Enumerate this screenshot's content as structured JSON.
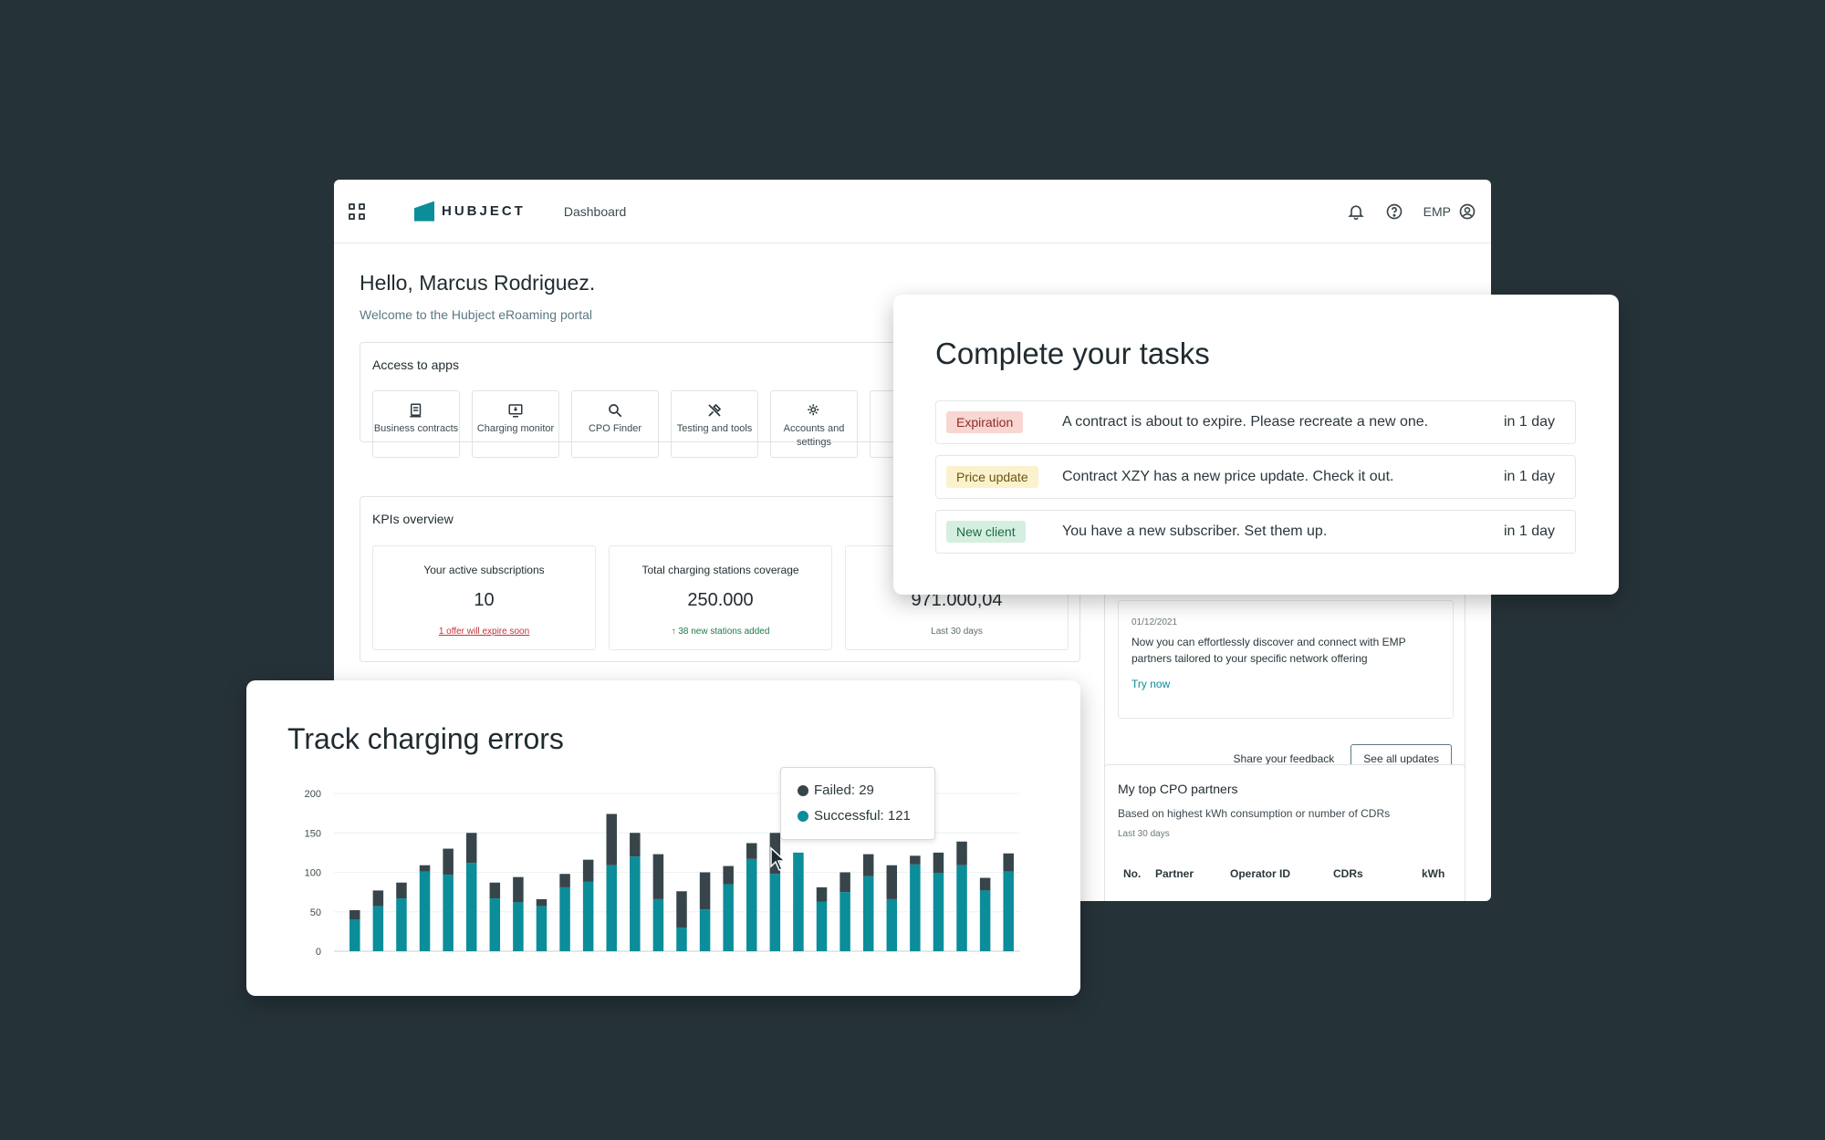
{
  "header": {
    "brand": "HUBJECT",
    "nav_item": "Dashboard",
    "role": "EMP"
  },
  "greeting": {
    "title": "Hello, Marcus Rodriguez.",
    "subtitle": "Welcome to the Hubject eRoaming portal"
  },
  "apps": {
    "title": "Access to apps",
    "items": [
      {
        "label": "Business contracts",
        "icon": "document-icon"
      },
      {
        "label": "Charging monitor",
        "icon": "monitor-icon"
      },
      {
        "label": "CPO Finder",
        "icon": "search-icon"
      },
      {
        "label": "Testing and tools",
        "icon": "tools-icon"
      },
      {
        "label": "Accounts and settings",
        "icon": "settings-icon"
      }
    ]
  },
  "kpis": {
    "title": "KPIs overview",
    "cards": [
      {
        "label": "Your active subscriptions",
        "value": "10",
        "note": "1 offer will expire soon"
      },
      {
        "label": "Total charging stations coverage",
        "value": "250.000",
        "note": "38 new stations added"
      },
      {
        "label": "",
        "value": "971.000,04",
        "note": "Last 30 days"
      }
    ]
  },
  "updates": {
    "date": "01/12/2021",
    "text": "Now you can effortlessly discover and connect with EMP partners tailored to your specific network offering",
    "link": "Try now",
    "feedback": "Share your feedback",
    "button": "See all updates"
  },
  "cpo_partners": {
    "title": "My top CPO partners",
    "subtitle": "Based on highest kWh consumption or number of CDRs",
    "range": "Last 30 days",
    "columns": [
      "No.",
      "Partner",
      "Operator ID",
      "CDRs",
      "kWh"
    ]
  },
  "tasks": {
    "title": "Complete your tasks",
    "items": [
      {
        "badge": "Expiration",
        "text": "A contract is about to expire. Please recreate a new one.",
        "when": "in 1 day"
      },
      {
        "badge": "Price update",
        "text": "Contract XZY has a new price update. Check it out.",
        "when": "in 1 day"
      },
      {
        "badge": "New client",
        "text": "You have a new subscriber. Set them up.",
        "when": "in 1 day"
      }
    ]
  },
  "chart": {
    "title": "Track charging errors",
    "tooltip_failed": "Failed: 29",
    "tooltip_successful": "Successful: 121"
  },
  "chart_data": {
    "type": "bar",
    "stacked": true,
    "title": "Track charging errors",
    "ylim": [
      0,
      200
    ],
    "yticks": [
      0,
      50,
      100,
      150,
      200
    ],
    "grid": true,
    "series": [
      {
        "name": "Successful",
        "color": "#0b8d9a",
        "values": [
          40,
          57,
          67,
          101,
          97,
          112,
          67,
          62,
          57,
          81,
          88,
          109,
          120,
          66,
          30,
          53,
          85,
          117,
          98,
          125,
          63,
          75,
          95,
          66,
          110,
          99,
          109,
          77,
          101
        ]
      },
      {
        "name": "Failed",
        "color": "#37454b",
        "values": [
          12,
          20,
          20,
          8,
          33,
          38,
          20,
          32,
          9,
          17,
          28,
          65,
          30,
          57,
          46,
          47,
          23,
          20,
          52,
          0,
          18,
          25,
          28,
          43,
          11,
          26,
          30,
          16,
          23
        ]
      }
    ]
  },
  "colors": {
    "background": "#253238",
    "accent": "#0b8d9a",
    "bar_failed": "#37454b"
  }
}
